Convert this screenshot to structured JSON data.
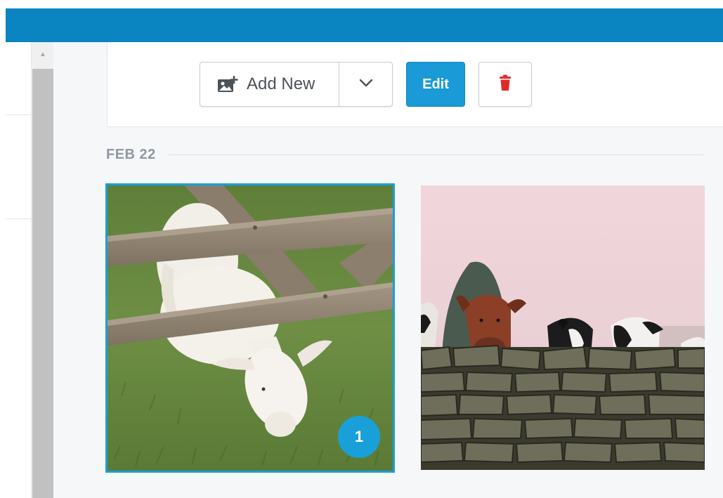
{
  "toolbar": {
    "add_new_label": "Add New",
    "edit_label": "Edit"
  },
  "gallery": {
    "groups": [
      {
        "date": "FEB 22",
        "photos": [
          {
            "subject": "lamb under wooden fence",
            "selected": true,
            "selection_index": "1"
          },
          {
            "subject": "cows behind stone wall",
            "selected": false
          }
        ]
      }
    ]
  },
  "colors": {
    "topbar": "#0a85c2",
    "accent": "#1aa0d8",
    "delete": "#e02b2b"
  },
  "icons": {
    "add_new": "add-image-icon",
    "dropdown": "chevron-down-icon",
    "delete": "trash-icon",
    "scroll_up": "scroll-up-arrow-icon"
  }
}
